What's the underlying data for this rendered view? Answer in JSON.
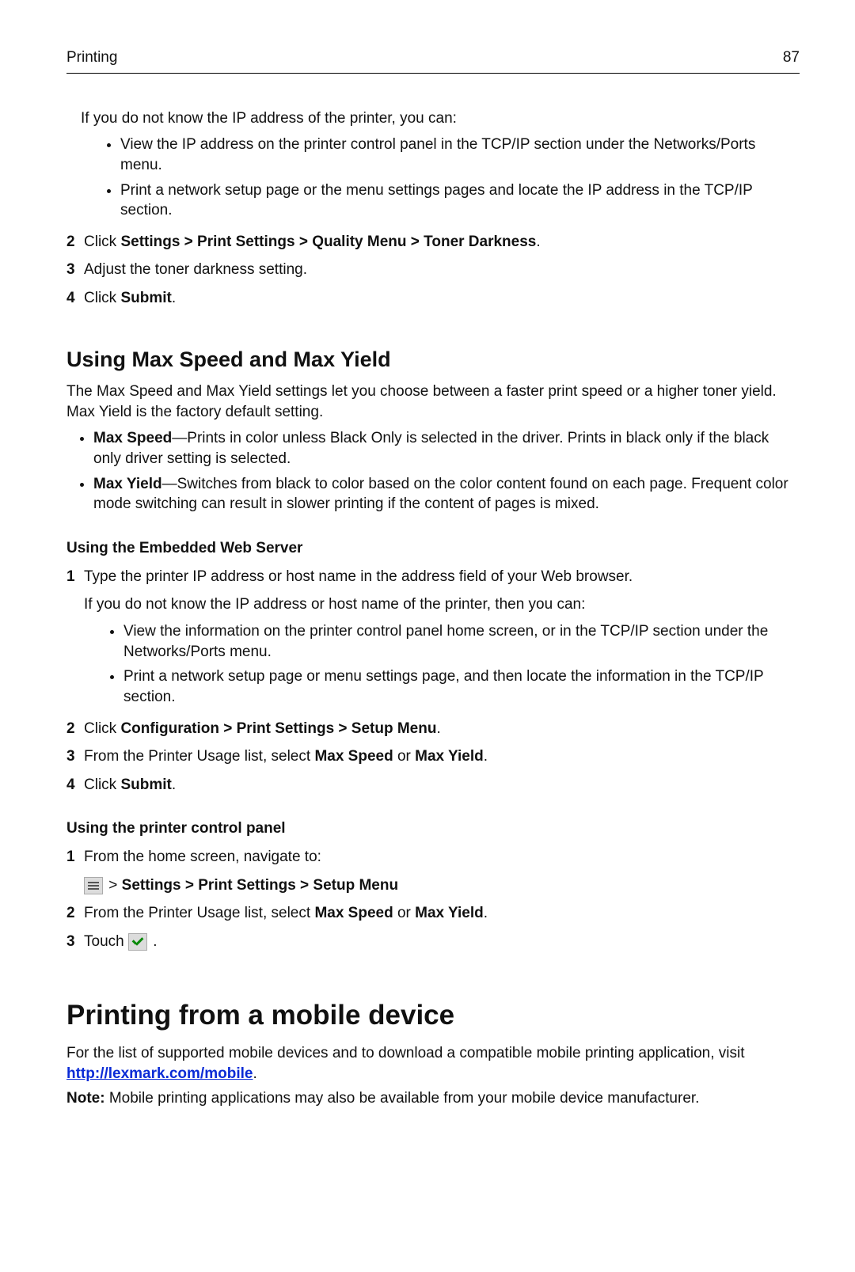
{
  "header": {
    "section": "Printing",
    "page": "87"
  },
  "intro": {
    "lead": "If you do not know the IP address of the printer, you can:",
    "bullets": [
      "View the IP address on the printer control panel in the TCP/IP section under the Networks/Ports menu.",
      "Print a network setup page or the menu settings pages and locate the IP address in the TCP/IP section."
    ]
  },
  "cont_steps": {
    "s2a": "Click ",
    "s2_path": "Settings > Print Settings > Quality Menu > Toner Darkness",
    "s2b": ".",
    "s3": "Adjust the toner darkness setting.",
    "s4a": "Click ",
    "s4b": "Submit",
    "s4c": "."
  },
  "sec1": {
    "title": "Using Max Speed and Max Yield",
    "para": "The Max Speed and Max Yield settings let you choose between a faster print speed or a higher toner yield. Max Yield is the factory default setting.",
    "b1_label": "Max Speed",
    "b1_text": "—Prints in color unless Black Only is selected in the driver. Prints in black only if the black only driver setting is selected.",
    "b2_label": "Max Yield",
    "b2_text": "—Switches from black to color based on the color content found on each page. Frequent color mode switching can result in slower printing if the content of pages is mixed."
  },
  "sub1": {
    "title": "Using the Embedded Web Server",
    "s1": "Type the printer IP address or host name in the address field of your Web browser.",
    "s1_note": "If you do not know the IP address or host name of the printer, then you can:",
    "s1_bullets": [
      "View the information on the printer control panel home screen, or in the TCP/IP section under the Networks/Ports menu.",
      "Print a network setup page or menu settings page, and then locate the information in the TCP/IP section."
    ],
    "s2a": "Click ",
    "s2_path": "Configuration > Print Settings > Setup Menu",
    "s2b": ".",
    "s3a": "From the Printer Usage list, select ",
    "s3_ms": "Max Speed",
    "s3_or": " or ",
    "s3_my": "Max Yield",
    "s3b": ".",
    "s4a": "Click ",
    "s4b": "Submit",
    "s4c": "."
  },
  "sub2": {
    "title": "Using the printer control panel",
    "s1": "From the home screen, navigate to:",
    "nav_a": " > ",
    "nav_path": "Settings > Print Settings > Setup Menu",
    "s2a": "From the Printer Usage list, select ",
    "s2_ms": "Max Speed",
    "s2_or": " or ",
    "s2_my": "Max Yield",
    "s2b": ".",
    "s3a": "Touch ",
    "s3b": " ."
  },
  "sec2": {
    "title": "Printing from a mobile device",
    "p1": "For the list of supported mobile devices and to download a compatible mobile printing application, visit ",
    "link": "http://lexmark.com/mobile",
    "p1_end": ".",
    "note_label": "Note:",
    "note_text": " Mobile printing applications may also be available from your mobile device manufacturer."
  }
}
